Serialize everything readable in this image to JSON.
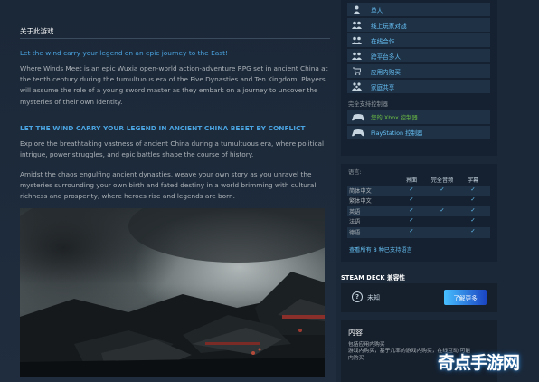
{
  "about": {
    "heading": "关于此游戏",
    "intro_heading": "Let the wind carry your legend on an epic journey to the East!",
    "intro_lines": [
      "Where Winds Meet is an epic Wuxia open-world action-adventure RPG set in ancient China at",
      "the tenth century during the tumultuous era of the Five Dynasties and Ten Kingdom. Players",
      "will assume the role of a young sword master as they embark on a journey to uncover the",
      "mysteries of their own identity."
    ],
    "section_heading": "LET THE WIND CARRY YOUR LEGEND IN ANCIENT CHINA BESET BY CONFLICT",
    "para2_lines": [
      "Explore the breathtaking vastness of ancient China during a tumultuous era, where political",
      "intrigue, power struggles, and epic battles shape the course of history."
    ],
    "para3_lines": [
      "Amidst the chaos engulfing ancient dynasties, weave your own story as you unravel the",
      "mysteries surrounding your own birth and fated destiny in a world brimming with cultural",
      "richness and prosperity, where heroes rise and legends are born."
    ]
  },
  "features": [
    {
      "label": "单人",
      "icon": "single-player-icon"
    },
    {
      "label": "线上玩家对战",
      "icon": "online-pvp-icon"
    },
    {
      "label": "在线合作",
      "icon": "online-coop-icon"
    },
    {
      "label": "跨平台多人",
      "icon": "cross-platform-icon"
    },
    {
      "label": "应用内购买",
      "icon": "in-app-purchase-icon"
    },
    {
      "label": "家庭共享",
      "icon": "family-sharing-icon"
    }
  ],
  "controllers": {
    "label": "完全支持控制器",
    "items": [
      {
        "label": "您的 Xbox 控制器",
        "icon": "xbox-controller-icon",
        "color": "#6dbe45"
      },
      {
        "label": "PlayStation 控制器",
        "icon": "playstation-controller-icon",
        "color": "#67c1f5"
      }
    ]
  },
  "languages": {
    "label": "语言:",
    "columns": [
      "界面",
      "完全音频",
      "字幕"
    ],
    "rows": [
      {
        "name": "简体中文",
        "checks": [
          true,
          true,
          true
        ]
      },
      {
        "name": "繁体中文",
        "checks": [
          true,
          false,
          true
        ]
      },
      {
        "name": "英语",
        "checks": [
          true,
          true,
          true
        ]
      },
      {
        "name": "法语",
        "checks": [
          true,
          false,
          true
        ]
      },
      {
        "name": "德语",
        "checks": [
          true,
          false,
          true
        ]
      }
    ],
    "check_mark": "✓",
    "more_link": "查看所有 8 种已支持语言"
  },
  "steam_deck": {
    "title": "STEAM DECK 兼容性",
    "status": "未知",
    "button": "了解更多"
  },
  "content": {
    "title": "内容",
    "lines": [
      "包括应用内购买",
      "游戏内购买，基于几率的游戏内购买，在线互动 可能",
      "内购买"
    ]
  },
  "watermark": "奇点手游网",
  "colors": {
    "accent_blue": "#67c1f5",
    "heading_blue": "#4aa3df",
    "background": "#1b2838"
  }
}
